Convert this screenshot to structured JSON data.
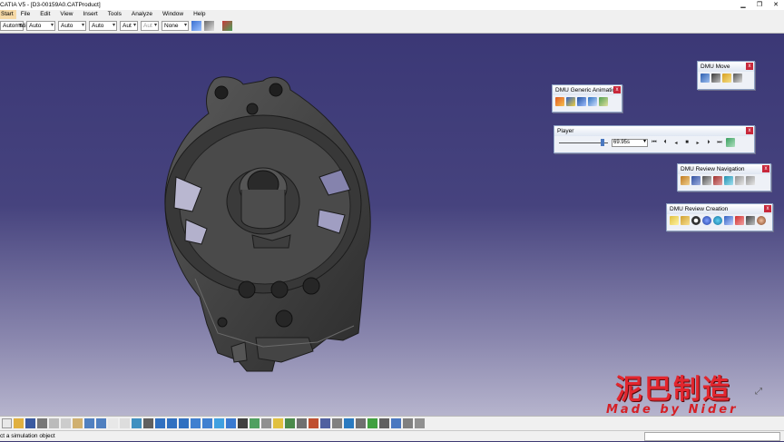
{
  "window": {
    "title": "CATIA V5 - [D3-00159A0.CATProduct]",
    "buttons": [
      "▁",
      "❐",
      "✕"
    ]
  },
  "menu": [
    "Start",
    "File",
    "Edit",
    "View",
    "Insert",
    "Tools",
    "Analyze",
    "Window",
    "Help"
  ],
  "toolbar": {
    "combos": [
      "Automatic",
      "Auto",
      "Auto",
      "Auto",
      "Aut",
      "Aut",
      "None"
    ]
  },
  "panels": {
    "dmu_move": {
      "title": "DMU Move",
      "icons": [
        "move-icon",
        "snap-icon",
        "smart-move-icon",
        "explode-icon"
      ]
    },
    "generic_animation": {
      "title": "DMU Generic Animation",
      "icons": [
        "simulation-icon",
        "compile-simulation-icon",
        "replay-icon",
        "simulation-player-icon",
        "edit-sequence-icon"
      ]
    },
    "player": {
      "title": "Player",
      "speed": "69.95s"
    },
    "review_navigation": {
      "title": "DMU Review Navigation",
      "icons": [
        "review-list-icon",
        "annotation-icon",
        "group-icon",
        "scene-icon",
        "fly-icon",
        "undo-view-icon",
        "redo-view-icon"
      ]
    },
    "review_creation": {
      "title": "DMU Review Creation",
      "icons": [
        "new-review-icon",
        "folder-icon",
        "info-icon",
        "sphere-icon",
        "globe-icon",
        "cut-icon",
        "flag-icon",
        "hyperlink-icon",
        "palette-icon"
      ]
    }
  },
  "watermark": {
    "cn": "泥巴制造",
    "en": "Made by Nider"
  },
  "status": {
    "text": "Select a simulation object",
    "visible_text": "ct a simulation object"
  },
  "colors": {
    "viewport_top": "#3b3876",
    "viewport_bottom": "#b6b4cd",
    "part": "#3c3c3c",
    "watermark": "#e3262e"
  }
}
